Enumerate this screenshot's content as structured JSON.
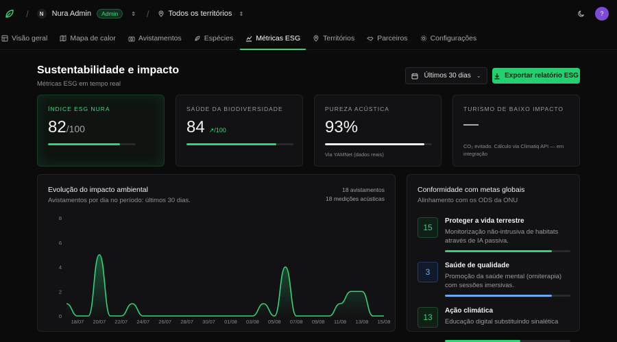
{
  "topbar": {
    "org_initial": "N",
    "org_name": "Nura Admin",
    "role_badge": "Admin",
    "territory": "Todos os territórios",
    "user_initial": "?"
  },
  "nav": [
    {
      "label": "Visão geral",
      "icon": "dashboard-icon",
      "active": false
    },
    {
      "label": "Mapa de calor",
      "icon": "map-icon",
      "active": false
    },
    {
      "label": "Avistamentos",
      "icon": "camera-icon",
      "active": false
    },
    {
      "label": "Espécies",
      "icon": "leaf-icon",
      "active": false
    },
    {
      "label": "Métricas ESG",
      "icon": "chart-icon",
      "active": true
    },
    {
      "label": "Territórios",
      "icon": "pin-icon",
      "active": false
    },
    {
      "label": "Parceiros",
      "icon": "handshake-icon",
      "active": false
    },
    {
      "label": "Configurações",
      "icon": "gear-icon",
      "active": false
    }
  ],
  "header": {
    "title": "Sustentabilidade e impacto",
    "subtitle": "Métricas ESG em tempo real",
    "range_label": "Últimos 30 dias",
    "export_label": "Exportar relatório ESG"
  },
  "cards": {
    "esg": {
      "label": "Índice ESG Nura",
      "value": "82",
      "unit": "/100",
      "progress": 0.82
    },
    "bio": {
      "label": "Saúde da biodiversidade",
      "value": "84",
      "trend": "/100",
      "progress": 0.84
    },
    "acoustic": {
      "label": "Pureza acústica",
      "value": "93%",
      "note": "Via YAMNet (dados reais)",
      "progress": 0.93
    },
    "tourism": {
      "label": "Turismo de baixo impacto",
      "value": "—",
      "note": "CO₂ evitado. Cálculo via Climatiq API — em integração"
    }
  },
  "impact": {
    "title": "Evolução do impacto ambiental",
    "subtitle": "Avistamentos por dia no período: últimos 30 dias.",
    "stat_sightings": "18 avistamentos",
    "stat_acoustic": "18 medições acústicas"
  },
  "goals_panel": {
    "title": "Conformidade com metas globais",
    "subtitle": "Alinhamento com os ODS da ONU",
    "goals": [
      {
        "num": "15",
        "title": "Proteger a vida terrestre",
        "desc": "Monitorização não-intrusiva de habitats através de IA passiva.",
        "progress": 0.85,
        "color": "#34d37a"
      },
      {
        "num": "3",
        "title": "Saúde de qualidade",
        "desc": "Promoção da saúde mental (orniterapia) com sessões imersivas.",
        "progress": 0.85,
        "color": "#6aa8f0"
      },
      {
        "num": "13",
        "title": "Ação climática",
        "desc": "Educação digital substituindo sinalética",
        "progress": 0.6,
        "color": "#34d37a"
      }
    ]
  },
  "chart_data": {
    "type": "area",
    "title": "Evolução do impacto ambiental",
    "xlabel": "",
    "ylabel": "",
    "ylim": [
      0,
      8
    ],
    "yticks": [
      "0",
      "2",
      "4",
      "6",
      "8"
    ],
    "xtick_labels": [
      "18/07",
      "20/07",
      "22/07",
      "24/07",
      "26/07",
      "28/07",
      "30/07",
      "01/08",
      "03/08",
      "05/08",
      "07/08",
      "09/08",
      "11/08",
      "13/08",
      "15/08"
    ],
    "x": [
      "17/07",
      "18/07",
      "19/07",
      "20/07",
      "21/07",
      "22/07",
      "23/07",
      "24/07",
      "25/07",
      "26/07",
      "27/07",
      "28/07",
      "29/07",
      "30/07",
      "31/07",
      "01/08",
      "02/08",
      "03/08",
      "04/08",
      "05/08",
      "06/08",
      "07/08",
      "08/08",
      "09/08",
      "10/08",
      "11/08",
      "12/08",
      "13/08",
      "14/08",
      "15/08"
    ],
    "values": [
      1,
      0,
      0,
      5,
      0,
      0,
      1,
      0,
      0,
      0,
      0,
      0,
      0,
      0,
      0,
      0,
      0,
      0,
      1,
      0,
      4,
      0,
      0,
      0,
      0,
      1,
      2,
      2,
      0,
      0
    ],
    "color": "#34d37a"
  }
}
